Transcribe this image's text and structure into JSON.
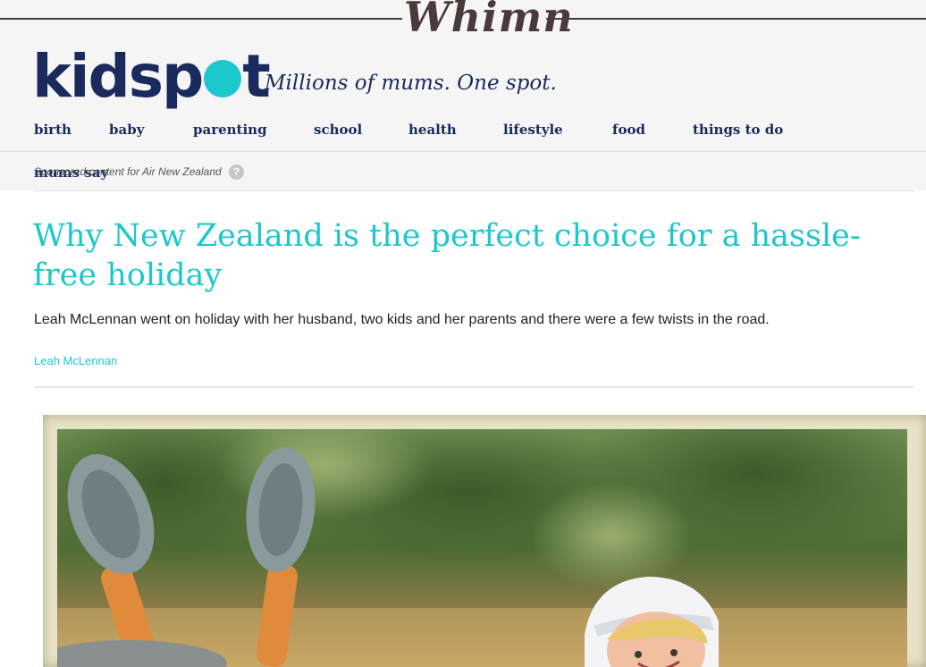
{
  "topbar": {
    "brand": "Whimn"
  },
  "logo": {
    "text_left": "kidsp",
    "text_right": "t",
    "dot_color": "#1cc8cc"
  },
  "tagline": "Millions of mums. One spot.",
  "nav": {
    "items": [
      "birth",
      "baby",
      "parenting",
      "school",
      "health",
      "lifestyle",
      "food",
      "things to do"
    ]
  },
  "subnav": {
    "item": "mums say"
  },
  "sponsored": {
    "text": "Sponsored content for Air New Zealand",
    "help_icon": "?"
  },
  "article": {
    "title": "Why New Zealand is the perfect choice for a hassle-free holiday",
    "standfirst": "Leah McLennan went on holiday with her husband, two kids and her parents and there were a few twists in the road.",
    "author": "Leah McLennan"
  },
  "colors": {
    "accent": "#1cc8cc",
    "navy": "#1a2a5c",
    "whimn": "#4a3a3c"
  }
}
